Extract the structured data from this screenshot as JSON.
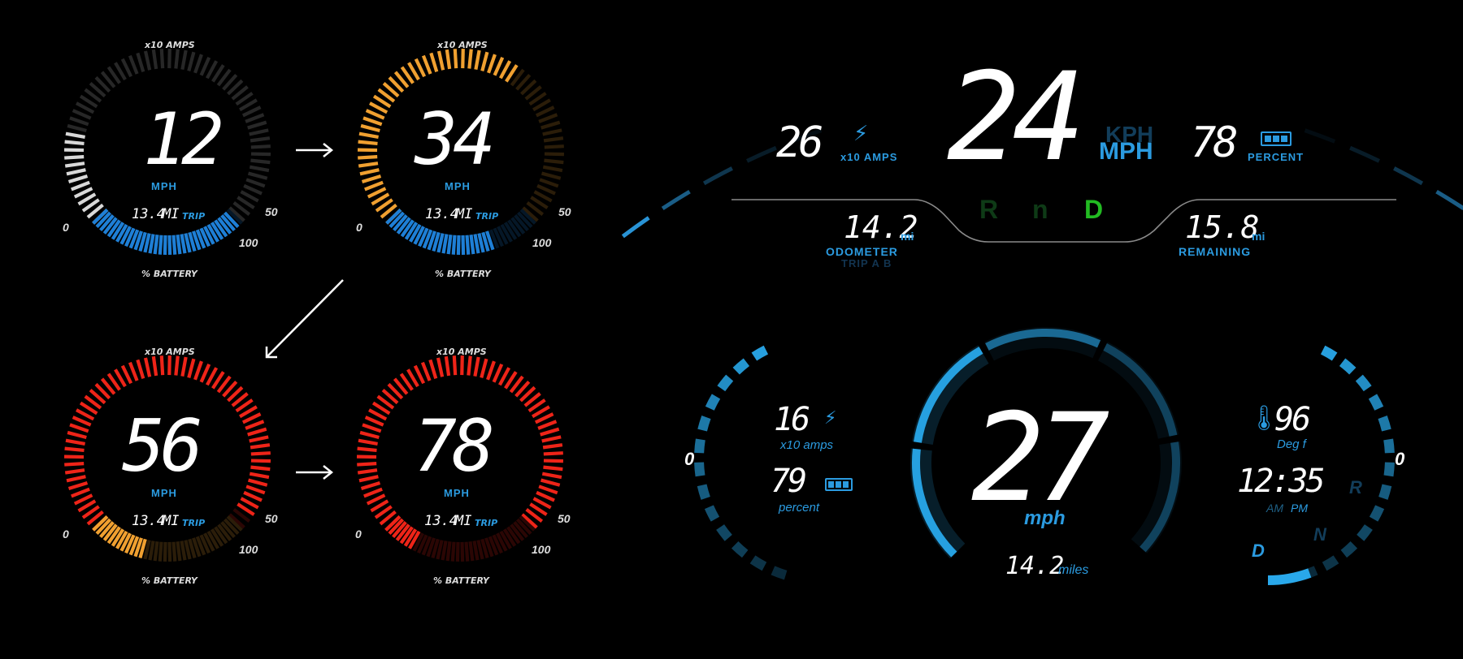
{
  "gauges": [
    {
      "id": "g1",
      "speed": "12",
      "unit": "MPH",
      "trip_value": "13.4",
      "trip_unit": "MI",
      "trip_label": "TRIP",
      "top_label": "x10 AMPS",
      "bottom_label": "% BATTERY",
      "scale_0": "0",
      "scale_50": "50",
      "scale_100": "100",
      "amps_color": "#d8d8d8",
      "amps_fraction": 0.22,
      "battery_color": "#1e7fd6",
      "battery_fraction": 0.98
    },
    {
      "id": "g2",
      "speed": "34",
      "unit": "MPH",
      "trip_value": "13.4",
      "trip_unit": "MI",
      "trip_label": "TRIP",
      "top_label": "x10 AMPS",
      "bottom_label": "% BATTERY",
      "scale_0": "0",
      "scale_50": "50",
      "scale_100": "100",
      "amps_color": "#f0a030",
      "amps_fraction": 0.64,
      "battery_color": "#1e7fd6",
      "battery_fraction": 0.72
    },
    {
      "id": "g3",
      "speed": "56",
      "unit": "MPH",
      "trip_value": "13.4",
      "trip_unit": "MI",
      "trip_label": "TRIP",
      "top_label": "x10 AMPS",
      "bottom_label": "% BATTERY",
      "scale_0": "0",
      "scale_50": "50",
      "scale_100": "100",
      "amps_color": "#ee2418",
      "amps_fraction": 0.97,
      "battery_color": "#f0a030",
      "battery_fraction": 0.34
    },
    {
      "id": "g4",
      "speed": "78",
      "unit": "MPH",
      "trip_value": "13.4",
      "trip_unit": "MI",
      "trip_label": "TRIP",
      "top_label": "x10 AMPS",
      "bottom_label": "% BATTERY",
      "scale_0": "0",
      "scale_50": "50",
      "scale_100": "100",
      "amps_color": "#ee2418",
      "amps_fraction": 1.0,
      "battery_color": "#ee2418",
      "battery_fraction": 0.22
    }
  ],
  "top_cluster": {
    "speed": "24",
    "unit_kph": "KPH",
    "unit_mph": "MPH",
    "amps_value": "26",
    "amps_label": "x10 AMPS",
    "battery_value": "78",
    "battery_label": "PERCENT",
    "gear_r": "R",
    "gear_n": "n",
    "gear_d": "D",
    "odometer_value": "14.2",
    "odometer_unit": "mi",
    "odometer_label": "ODOMETER",
    "odometer_sub": "TRIP A B",
    "remaining_value": "15.8",
    "remaining_unit": "mi",
    "remaining_label": "REMAINING",
    "accent_color": "#2b9be0",
    "active_gear_color": "#22bb22"
  },
  "bottom_cluster": {
    "speed": "27",
    "speed_unit": "mph",
    "amps_value": "16",
    "amps_label": "x10 amps",
    "battery_value": "79",
    "battery_label": "percent",
    "distance_value": "14.2",
    "distance_unit": "miles",
    "temp_value": "96",
    "temp_label": "Deg f",
    "time_value": "12:35",
    "time_am": "AM",
    "time_pm": "PM",
    "zero_left": "0",
    "zero_right": "0",
    "gear_r": "R",
    "gear_n": "N",
    "gear_d": "D",
    "accent_color": "#29a8ea"
  },
  "icons": [
    "arrow-right-icon",
    "arrow-down-left-icon",
    "lightning-icon",
    "battery-icon",
    "thermometer-icon"
  ]
}
